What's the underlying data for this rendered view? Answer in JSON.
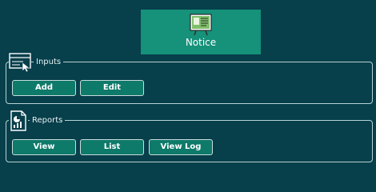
{
  "header": {
    "title": "Notice"
  },
  "inputs": {
    "label": "Inputs",
    "buttons": [
      "Add",
      "Edit"
    ]
  },
  "reports": {
    "label": "Reports",
    "buttons": [
      "View",
      "List",
      "View Log"
    ]
  },
  "colors": {
    "background": "#073f4b",
    "header_fill": "#16917a",
    "button_fill": "#0e7a6a",
    "border": "#b9d3d6"
  }
}
